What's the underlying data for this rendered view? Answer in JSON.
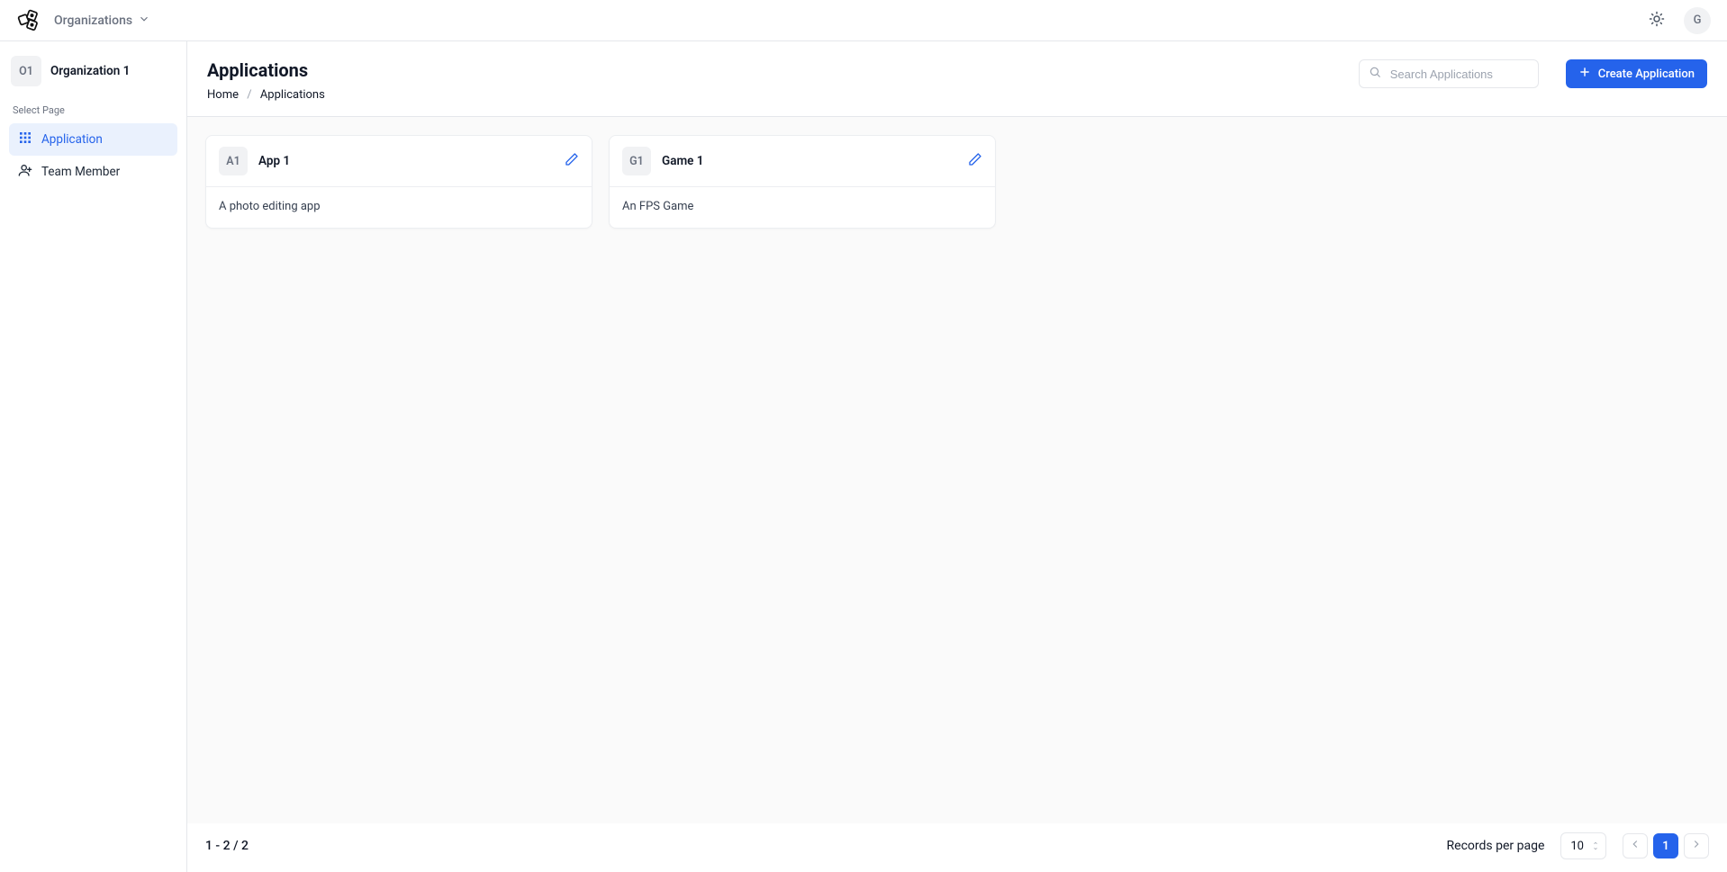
{
  "top": {
    "org_dropdown_label": "Organizations",
    "avatar_initial": "G"
  },
  "sidebar": {
    "org_badge": "O1",
    "org_name": "Organization 1",
    "section_label": "Select Page",
    "items": [
      {
        "label": "Application"
      },
      {
        "label": "Team Member"
      }
    ]
  },
  "header": {
    "title": "Applications",
    "breadcrumb": {
      "home": "Home",
      "current": "Applications"
    },
    "search_placeholder": "Search Applications",
    "create_label": "Create Application"
  },
  "applications": [
    {
      "badge": "A1",
      "name": "App 1",
      "description": "A photo editing app"
    },
    {
      "badge": "G1",
      "name": "Game 1",
      "description": "An FPS Game"
    }
  ],
  "footer": {
    "range": "1 - 2 / 2",
    "records_label": "Records per page",
    "records_value": "10",
    "page": "1"
  }
}
